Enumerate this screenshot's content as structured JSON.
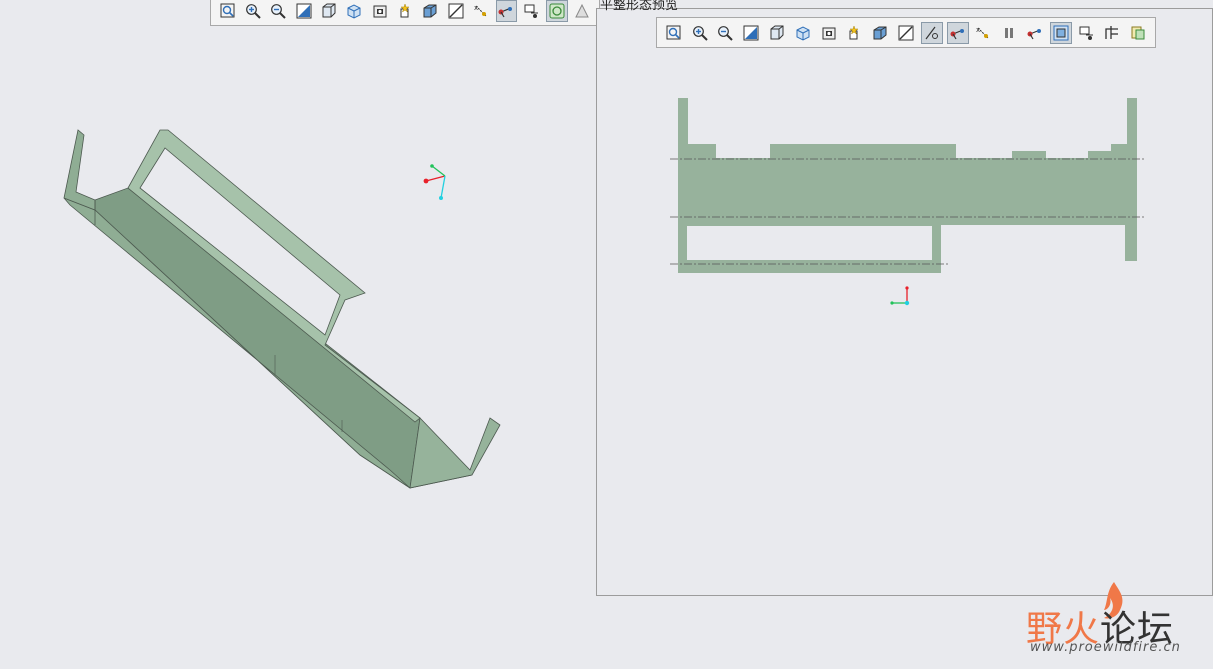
{
  "colors": {
    "background": "#e9eaee",
    "part_face": "#8fad94",
    "part_face_dark": "#7f9d85",
    "part_face_light": "#a6c2aa",
    "part_edge": "#4d5a50",
    "flat_pattern": "#97b29c",
    "bend_line": "#555555",
    "axis_x": "#e8212a",
    "axis_y": "#22c25a",
    "axis_z": "#22d0e0",
    "watermark_accent": "#f07848"
  },
  "main_toolbar": {
    "buttons": [
      {
        "icon": "refit-icon"
      },
      {
        "icon": "zoom-in-icon"
      },
      {
        "icon": "zoom-out-icon"
      },
      {
        "icon": "repaint-icon"
      },
      {
        "icon": "display-style-icon"
      },
      {
        "icon": "saved-orientations-icon"
      },
      {
        "icon": "view-manager-icon"
      },
      {
        "icon": "perspective-view-icon"
      },
      {
        "icon": "section-view-icon"
      },
      {
        "icon": "cut-icon"
      },
      {
        "icon": "datum-display-icon"
      },
      {
        "icon": "annotation-display-icon",
        "active": true
      },
      {
        "icon": "spin-center-icon"
      },
      {
        "icon": "appearance-icon",
        "active": true
      },
      {
        "icon": "more-icon"
      }
    ]
  },
  "preview_window": {
    "title": "平整形态预览",
    "toolbar": {
      "buttons": [
        {
          "icon": "refit-icon"
        },
        {
          "icon": "zoom-in-icon"
        },
        {
          "icon": "zoom-out-icon"
        },
        {
          "icon": "repaint-icon"
        },
        {
          "icon": "display-style-icon"
        },
        {
          "icon": "saved-orientations-icon"
        },
        {
          "icon": "view-manager-icon"
        },
        {
          "icon": "perspective-view-icon"
        },
        {
          "icon": "section-view-icon"
        },
        {
          "icon": "cut-icon"
        },
        {
          "icon": "plane-display-icon",
          "active": true
        },
        {
          "icon": "axis-display-icon",
          "active": true
        },
        {
          "icon": "point-display-icon"
        },
        {
          "icon": "pause-icon"
        },
        {
          "icon": "annotation-display-icon"
        },
        {
          "icon": "csys-display-icon",
          "active": true
        },
        {
          "icon": "spin-center-icon"
        },
        {
          "icon": "sync-view-icon"
        },
        {
          "icon": "update-preview-icon"
        }
      ]
    }
  },
  "watermark": {
    "text_accent": "野火",
    "text_rest": "论坛",
    "url": "www.proewildfire.cn"
  }
}
